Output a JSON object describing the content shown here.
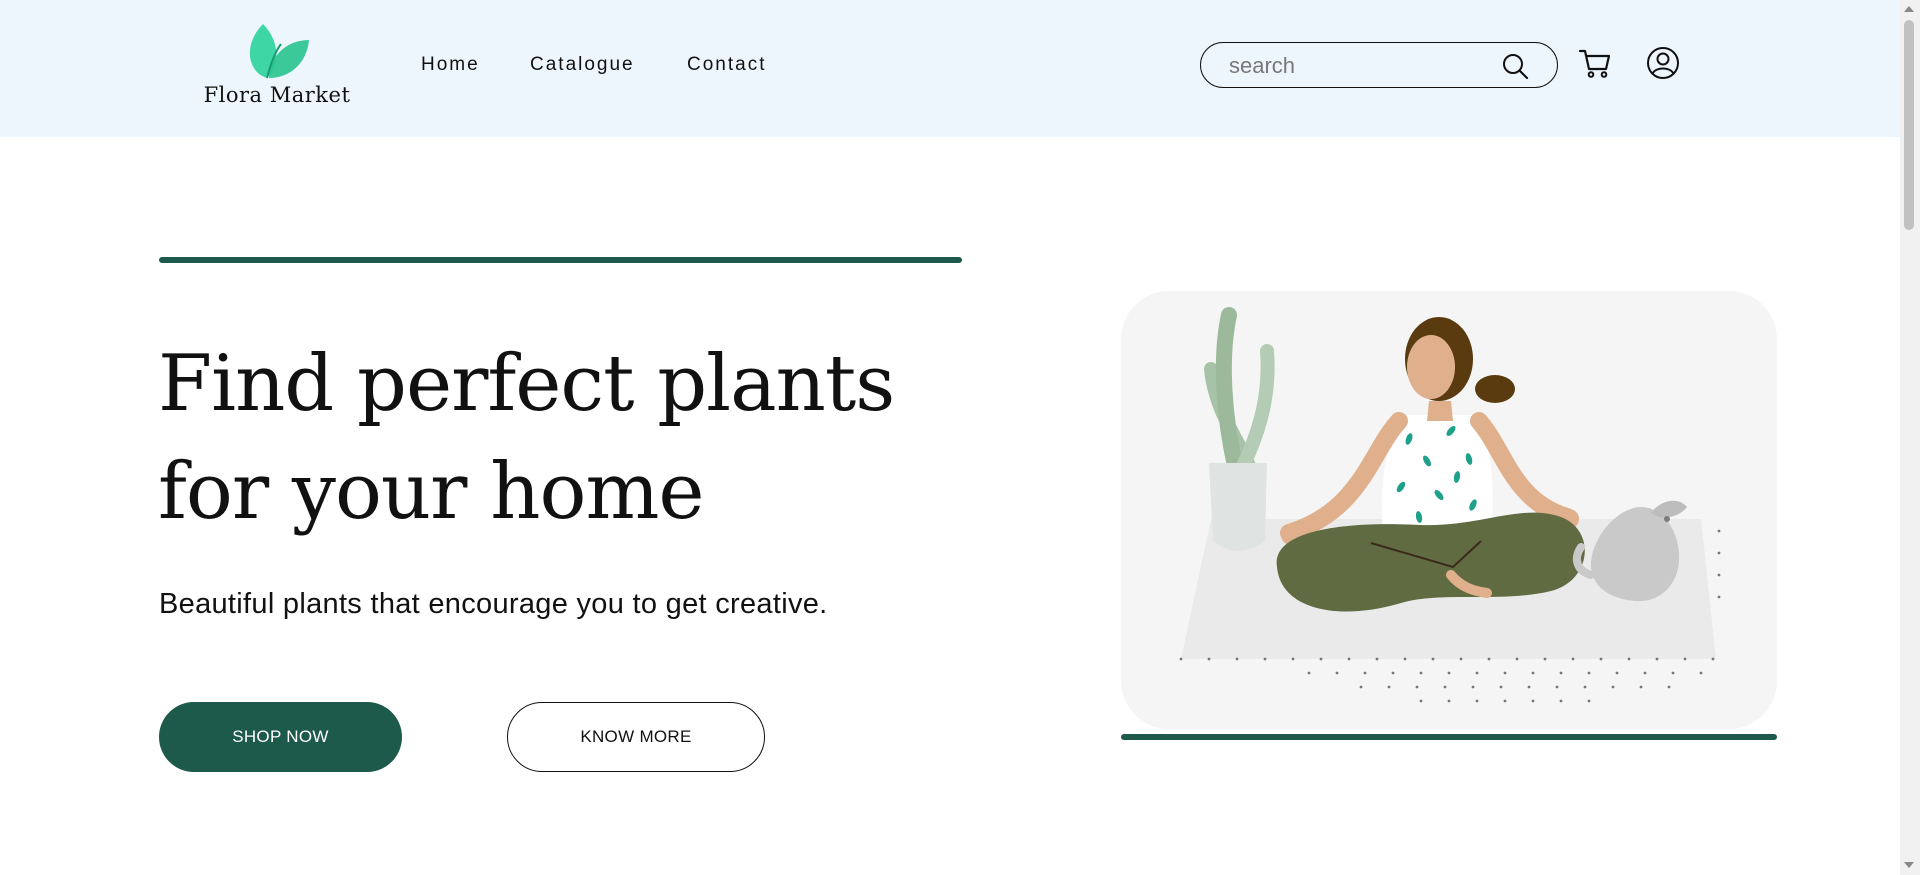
{
  "header": {
    "brand": "Flora Market",
    "nav": [
      {
        "label": "Home"
      },
      {
        "label": "Catalogue"
      },
      {
        "label": "Contact"
      }
    ],
    "search": {
      "placeholder": "search",
      "icon": "search-icon"
    },
    "cart_icon": "cart-icon",
    "account_icon": "user-icon"
  },
  "hero": {
    "headline": "Find perfect plants for your home",
    "subtitle": "Beautiful plants that encourage you to get creative.",
    "primary_button": "SHOP NOW",
    "secondary_button": "KNOW MORE"
  },
  "colors": {
    "header_bg": "#eef6fd",
    "accent": "#1d5a4c",
    "logo_green": "#2ecf9a",
    "card_bg": "#f5f5f5"
  }
}
